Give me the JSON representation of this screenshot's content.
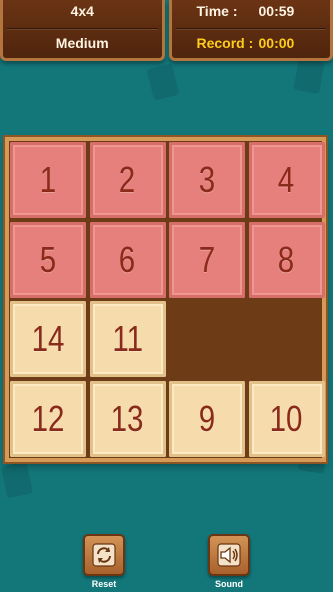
{
  "header": {
    "size_label": "4x4",
    "difficulty_label": "Medium",
    "time_label": "Time :",
    "time_value": "00:59",
    "record_label": "Record :",
    "record_value": "00:00"
  },
  "board": {
    "rows": 4,
    "cols": 4,
    "tiles": [
      "1",
      "2",
      "3",
      "4",
      "5",
      "6",
      "7",
      "8",
      "14",
      "11",
      "",
      "",
      "12",
      "13",
      "9",
      "10"
    ],
    "tile_colors": [
      "red",
      "red",
      "red",
      "red",
      "red",
      "red",
      "red",
      "red",
      "cream",
      "cream",
      "empty",
      "empty",
      "cream",
      "cream",
      "cream",
      "cream"
    ]
  },
  "controls": {
    "reset_label": "Reset",
    "sound_label": "Sound"
  },
  "colors": {
    "background": "#13777a",
    "panel": "#5a2c10",
    "tile_red": "#e6807c",
    "tile_cream": "#f6dcac",
    "record_accent": "#ffcc1c"
  }
}
